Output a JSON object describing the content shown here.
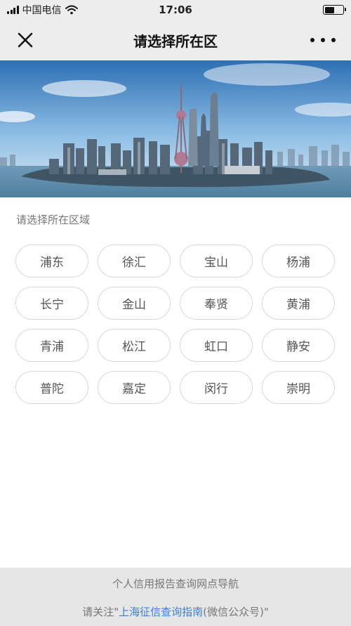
{
  "status_bar": {
    "carrier": "中国电信",
    "time": "17:06",
    "battery_level": 0.55
  },
  "nav": {
    "title": "请选择所在区",
    "close_icon": "close-icon",
    "more_icon": "more-icon"
  },
  "banner": {
    "icon": "city-skyline-image"
  },
  "section": {
    "label": "请选择所在区域"
  },
  "districts": [
    "浦东",
    "徐汇",
    "宝山",
    "杨浦",
    "长宁",
    "金山",
    "奉贤",
    "黄浦",
    "青浦",
    "松江",
    "虹口",
    "静安",
    "普陀",
    "嘉定",
    "闵行",
    "崇明"
  ],
  "footer": {
    "line1": "个人信用报告查询网点导航",
    "line2_prefix": "请关注\"",
    "link_text": "上海征信查询指南",
    "line2_suffix": "(微信公众号)\""
  },
  "colors": {
    "nav_bg": "#ededed",
    "link": "#3b7fd3",
    "footer_bg": "#e6e6e6"
  }
}
